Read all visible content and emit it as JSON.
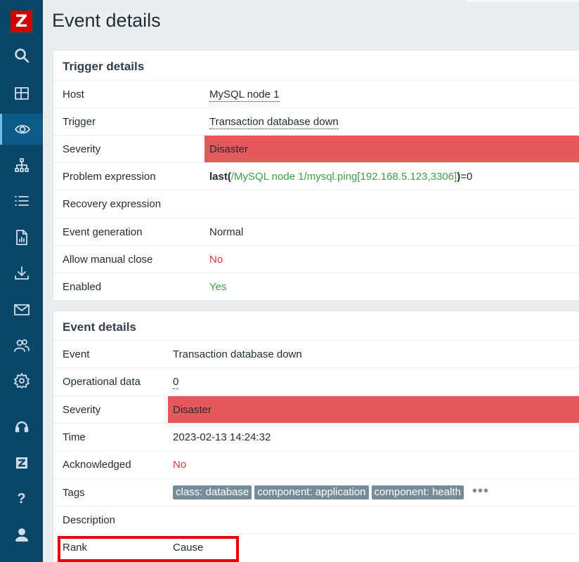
{
  "app": {
    "logo_letter": "Z"
  },
  "sidebar": {
    "items": [
      {
        "name": "search-icon",
        "active": false
      },
      {
        "name": "dashboard-icon",
        "active": false
      },
      {
        "name": "monitoring-eye-icon",
        "active": true
      },
      {
        "name": "services-tree-icon",
        "active": false
      },
      {
        "name": "inventory-list-icon",
        "active": false
      },
      {
        "name": "reports-icon",
        "active": false
      },
      {
        "name": "data-collection-download-icon",
        "active": false
      },
      {
        "name": "alerts-mail-icon",
        "active": false
      },
      {
        "name": "users-icon",
        "active": false
      },
      {
        "name": "administration-gear-icon",
        "active": false
      },
      {
        "name": "support-headset-icon",
        "active": false
      },
      {
        "name": "zabbix-share-icon",
        "active": false
      },
      {
        "name": "help-icon",
        "active": false
      },
      {
        "name": "user-settings-icon",
        "active": false
      }
    ],
    "help_label": "?"
  },
  "header": {
    "title": "Event details"
  },
  "trigger": {
    "title": "Trigger details",
    "host_label": "Host",
    "host_value": "MySQL node 1",
    "trigger_label": "Trigger",
    "trigger_value": "Transaction database down",
    "severity_label": "Severity",
    "severity_value": "Disaster",
    "problem_expr_label": "Problem expression",
    "expr": {
      "fn": "last",
      "open": "(",
      "item": "/MySQL node 1/mysql.ping[192.168.5.123,3306]",
      "close": ")",
      "op": "=0"
    },
    "recovery_label": "Recovery expression",
    "recovery_value": "",
    "generation_label": "Event generation",
    "generation_value": "Normal",
    "manual_close_label": "Allow manual close",
    "manual_close_value": "No",
    "enabled_label": "Enabled",
    "enabled_value": "Yes"
  },
  "event": {
    "title": "Event details",
    "event_label": "Event",
    "event_value": "Transaction database down",
    "opdata_label": "Operational data",
    "opdata_value": "0",
    "severity_label": "Severity",
    "severity_value": "Disaster",
    "time_label": "Time",
    "time_value": "2023-02-13 14:24:32",
    "ack_label": "Acknowledged",
    "ack_value": "No",
    "tags_label": "Tags",
    "tags": [
      "class: database",
      "component: application",
      "component: health"
    ],
    "more_tags": "•••",
    "description_label": "Description",
    "rank_label": "Rank",
    "rank_value": "Cause"
  },
  "colors": {
    "severity_disaster": "#e45959",
    "sidebar": "#0a466a",
    "no": "#e33734",
    "yes": "#429e47",
    "highlight": "#e60000"
  }
}
